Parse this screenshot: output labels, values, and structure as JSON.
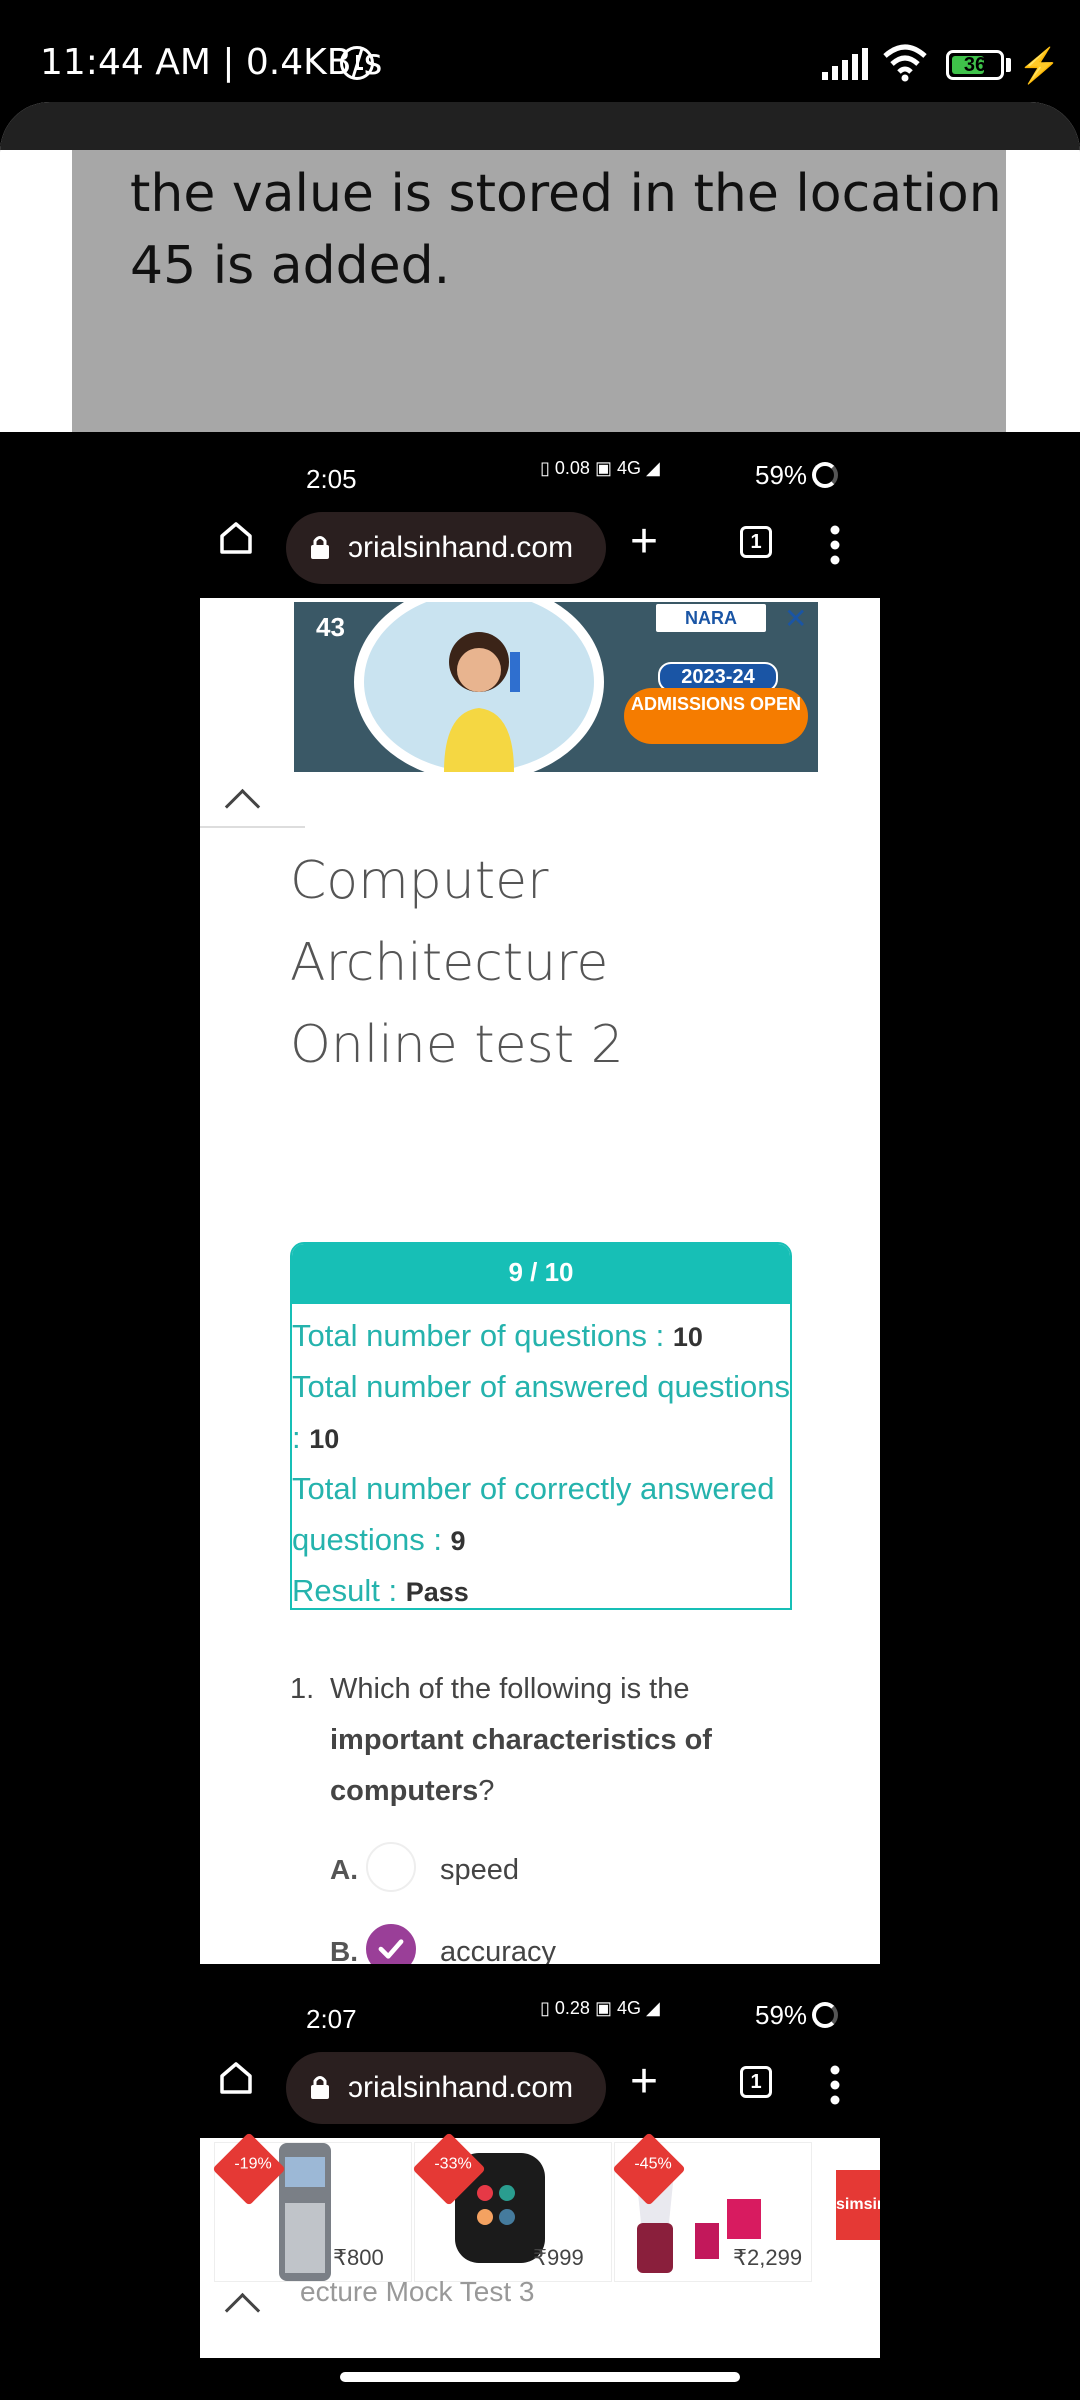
{
  "status_bar": {
    "time": "11:44 AM | 0.4KB/s",
    "battery": "36"
  },
  "top_sheet": {
    "text": "the value is stored in the location 45 is added."
  },
  "panel1": {
    "status": {
      "time": "2:05",
      "speed": "0.08",
      "network": "4G",
      "battery": "59%"
    },
    "browser": {
      "url": "ɔrialsinhand.com",
      "tabs_count": "1"
    },
    "ad": {
      "years": "43",
      "brand": "NARA",
      "year": "2023-24",
      "cta": "ADMISSIONS OPEN"
    },
    "title": "Computer Architecture Online test 2",
    "result": {
      "score": "9 / 10",
      "lines": [
        {
          "label": "Total number of questions : ",
          "value": "10"
        },
        {
          "label": "Total number of answered questions : ",
          "value": "10"
        },
        {
          "label": "Total number of correctly answered questions : ",
          "value": "9"
        },
        {
          "label": "Result : ",
          "value": "Pass"
        }
      ]
    },
    "question": {
      "number": "1.",
      "prefix": "Which of the following is the ",
      "bold": "important characteristics of computers",
      "suffix": "?",
      "options": [
        {
          "letter": "A.",
          "text": "speed",
          "selected": false
        },
        {
          "letter": "B.",
          "text": "accuracy",
          "selected": true
        }
      ]
    }
  },
  "panel2": {
    "status": {
      "time": "2:07",
      "speed": "0.28",
      "network": "4G",
      "battery": "59%"
    },
    "browser": {
      "url": "ɔrialsinhand.com",
      "tabs_count": "1"
    },
    "products": [
      {
        "discount": "-19%",
        "price": "₹800"
      },
      {
        "discount": "-33%",
        "price": "₹999"
      },
      {
        "discount": "-45%",
        "price": "₹2,299"
      }
    ],
    "brand_tile": "simsir",
    "partial_text": "ecture Mock Test 3"
  }
}
